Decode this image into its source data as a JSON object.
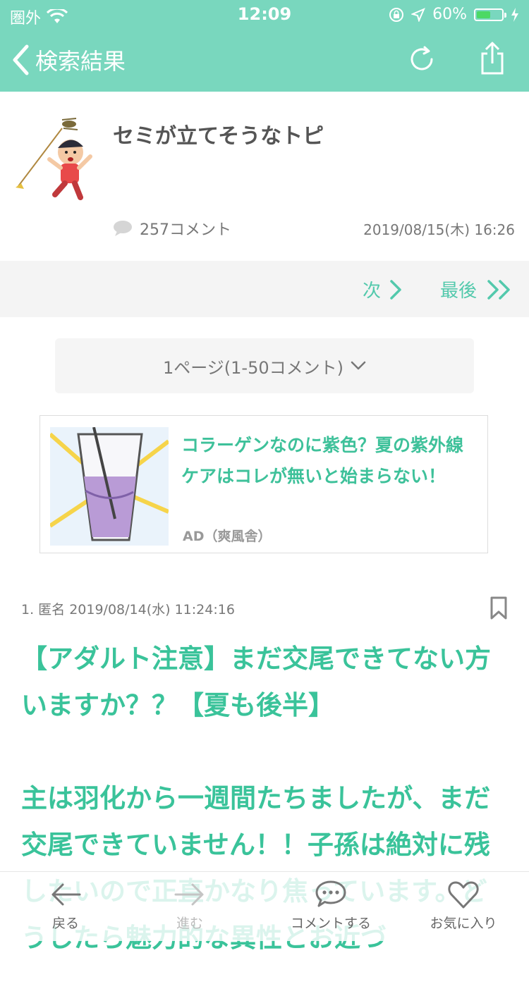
{
  "status_bar": {
    "carrier": "圏外",
    "time": "12:09",
    "battery": "60%",
    "battery_level": 0.6
  },
  "nav": {
    "back_label": "検索結果",
    "icons": [
      "chevron-left-icon",
      "reload-icon",
      "share-icon"
    ]
  },
  "topic": {
    "title": "セミが立てそうなトピ",
    "comment_count": "257コメント",
    "date": "2019/08/15(木) 16:26"
  },
  "pager": {
    "next_label": "次",
    "last_label": "最後"
  },
  "page_select": {
    "label": "1ページ(1-50コメント)"
  },
  "ad": {
    "headline": "コラーゲンなのに紫色？夏の紫外線ケアはコレが無いと始まらない！",
    "sponsor": "AD（爽風舎）"
  },
  "comment": {
    "meta": "1. 匿名 2019/08/14(水) 11:24:16",
    "paragraph1": "【アダルト注意】まだ交尾できてない方いますか？？【夏も後半】",
    "paragraph2": "主は羽化から一週間たちましたが、まだ交尾できていません！！子孫は絶対に残したいので正直かなり焦っています。どうしたら魅力的な異性とお近づ"
  },
  "toolbar": {
    "back": "戻る",
    "forward": "進む",
    "comment": "コメントする",
    "favorite": "お気に入り"
  },
  "colors": {
    "accent": "#79d7be",
    "text_accent": "#3ac39a",
    "battery_fill": "#4cd964"
  }
}
